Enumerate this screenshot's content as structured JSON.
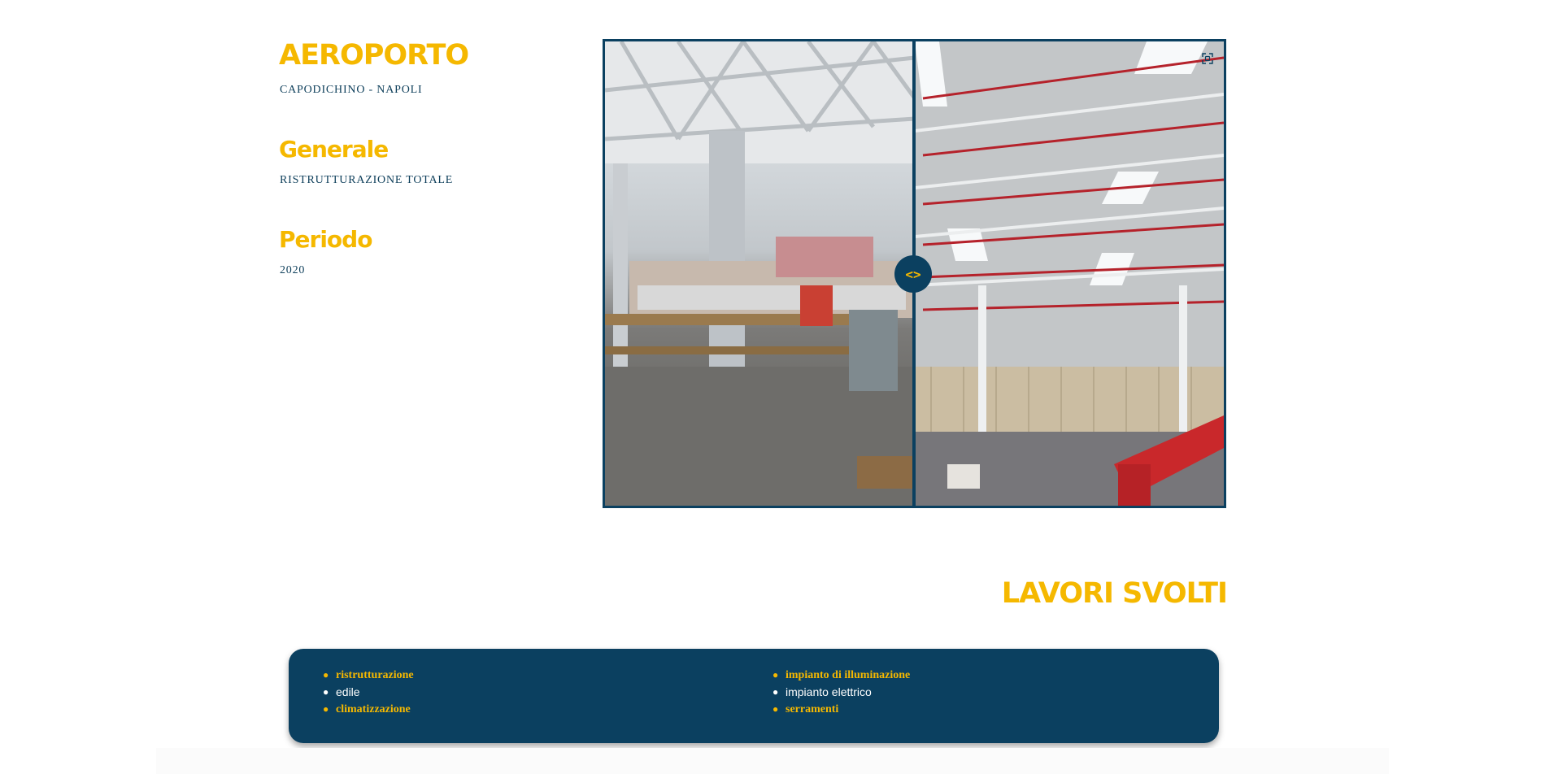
{
  "project": {
    "title": "AEROPORTO",
    "subtitle": "CAPODICHINO - NAPOLI"
  },
  "generale": {
    "heading": "Generale",
    "value": "RISTRUTTURAZIONE TOTALE"
  },
  "periodo": {
    "heading": "Periodo",
    "value": "2020"
  },
  "comparison": {
    "handle_label": "<>",
    "handle_icon": "arrows-left-right-icon",
    "fullscreen_icon": "fullscreen-icon"
  },
  "lavori": {
    "title": "LAVORI SVOLTI",
    "column_1": [
      "ristrutturazione",
      "edile",
      "climatizzazione"
    ],
    "column_2": [
      "impianto di illuminazione",
      "impianto elettrico",
      "serramenti"
    ]
  },
  "colors": {
    "accent": "#f5b800",
    "primary": "#0b4060",
    "text_dark": "#0d3e5a"
  }
}
